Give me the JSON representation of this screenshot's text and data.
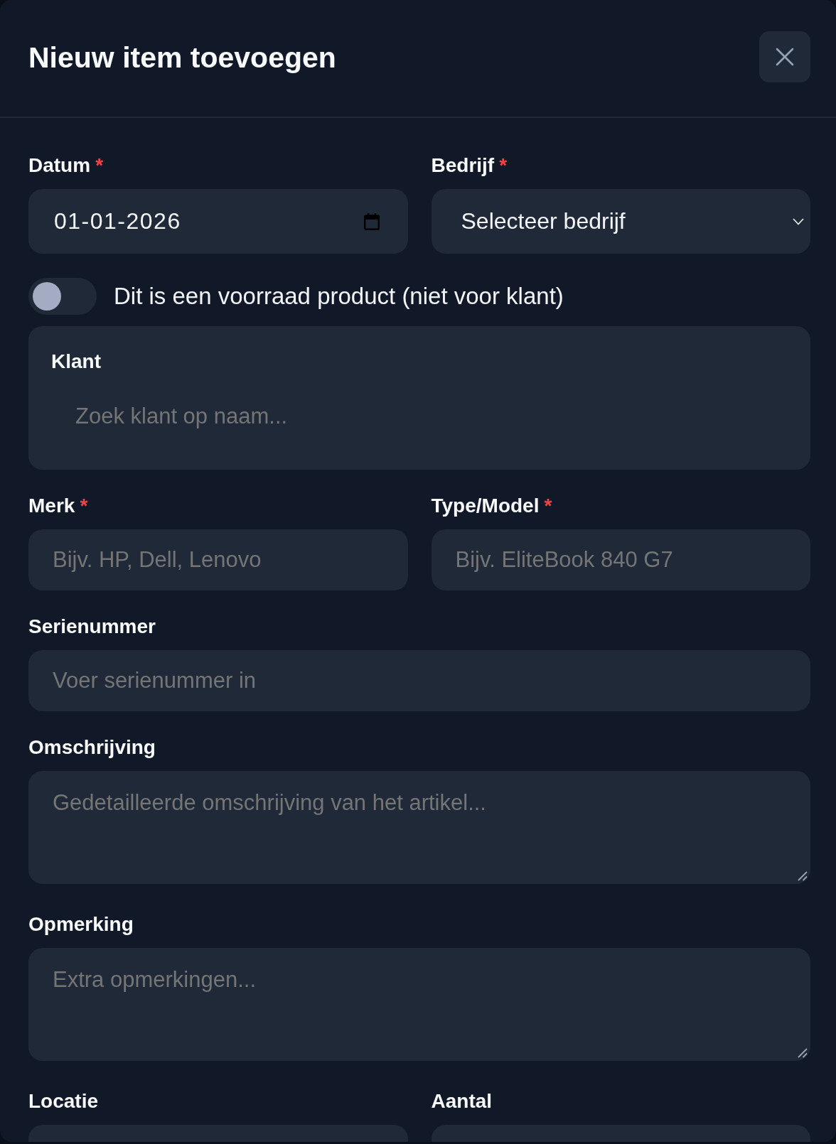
{
  "dialog": {
    "title": "Nieuw item toevoegen"
  },
  "form": {
    "rows": [
      {
        "kind": "fields",
        "fields": [
          {
            "kind": "date",
            "label": "Datum",
            "required_mark": "*",
            "value": "01-01-2026"
          },
          {
            "kind": "select",
            "label": "Bedrijf",
            "required_mark": "*",
            "value": "Selecteer bedrijf"
          }
        ]
      },
      {
        "kind": "toggle",
        "label": "Dit is een voorraad product (niet voor klant)",
        "on": false
      },
      {
        "kind": "panel",
        "label": "Klant",
        "placeholder": "Zoek klant op naam..."
      },
      {
        "kind": "fields",
        "fields": [
          {
            "kind": "text",
            "label": "Merk",
            "required_mark": "*",
            "placeholder": "Bijv. HP, Dell, Lenovo"
          },
          {
            "kind": "text",
            "label": "Type/Model",
            "required_mark": "*",
            "placeholder": "Bijv. EliteBook 840 G7"
          }
        ]
      },
      {
        "kind": "fields",
        "fields": [
          {
            "kind": "text",
            "label": "Serienummer",
            "placeholder": "Voer serienummer in"
          }
        ]
      },
      {
        "kind": "fields",
        "fields": [
          {
            "kind": "textarea",
            "label": "Omschrijving",
            "placeholder": "Gedetailleerde omschrijving van het artikel..."
          }
        ]
      },
      {
        "kind": "fields",
        "fields": [
          {
            "kind": "textarea",
            "label": "Opmerking",
            "placeholder": "Extra opmerkingen..."
          }
        ]
      },
      {
        "kind": "fields",
        "fields": [
          {
            "kind": "text",
            "label": "Locatie"
          },
          {
            "kind": "text",
            "label": "Aantal"
          }
        ]
      }
    ]
  }
}
